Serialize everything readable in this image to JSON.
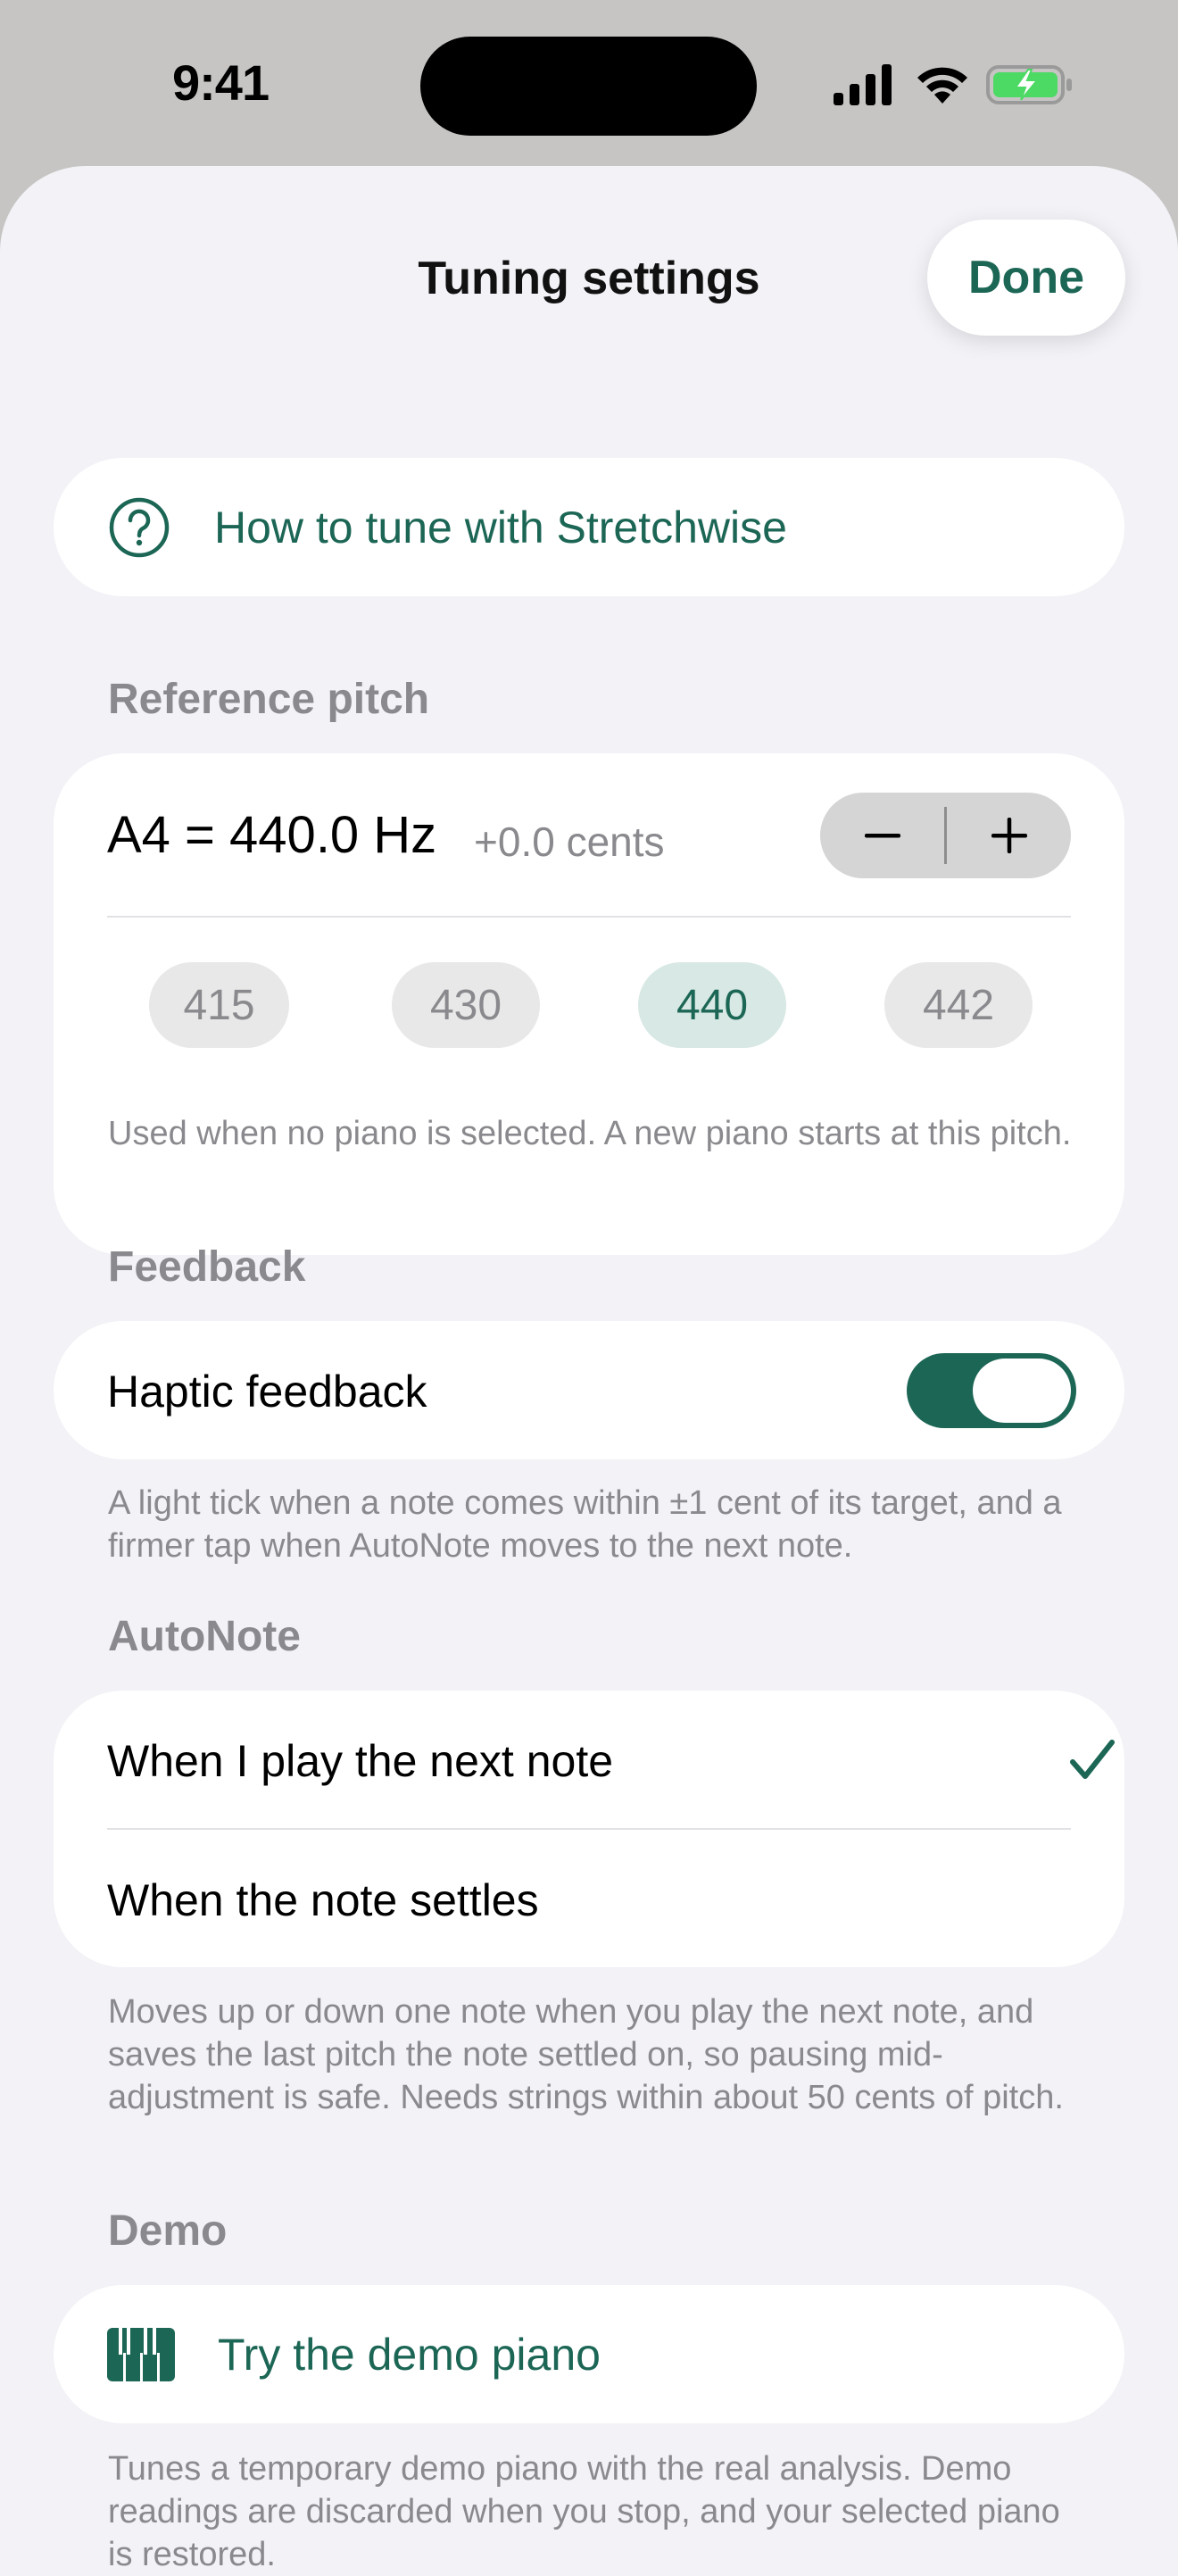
{
  "status_bar": {
    "time": "9:41"
  },
  "sheet": {
    "title": "Tuning settings",
    "done_label": "Done"
  },
  "help_link": {
    "label": "How to tune with Stretchwise",
    "icon": "question-circle-icon"
  },
  "reference_pitch": {
    "header": "Reference pitch",
    "pitch_label": "A4 = 440.0 Hz",
    "cents_label": "+0.0 cents",
    "presets": [
      "415",
      "430",
      "440",
      "442"
    ],
    "selected_preset": "440",
    "footnote": "Used when no piano is selected. A new piano starts at this pitch."
  },
  "feedback": {
    "header": "Feedback",
    "haptic_label": "Haptic feedback",
    "haptic_enabled": true,
    "footnote": "A light tick when a note comes within ±1 cent of its target, and a firmer tap when AutoNote moves to the next note."
  },
  "autonote": {
    "header": "AutoNote",
    "options": [
      "When I play the next note",
      "When the note settles"
    ],
    "selected_option": "When I play the next note",
    "footnote": "Moves up or down one note when you play the next note, and saves the last pitch the note settled on, so pausing mid-adjustment is safe. Needs strings within about 50 cents of pitch."
  },
  "demo": {
    "header": "Demo",
    "button_label": "Try the demo piano",
    "icon": "piano-keys-icon",
    "footnote": "Tunes a temporary demo piano with the real analysis. Demo readings are discarded when you stop, and your selected piano is restored."
  },
  "colors": {
    "accent": "#1c6655",
    "sheet_background": "#f2f2f7",
    "secondary_text": "#8a8a8e",
    "battery_green": "#4cd964"
  }
}
